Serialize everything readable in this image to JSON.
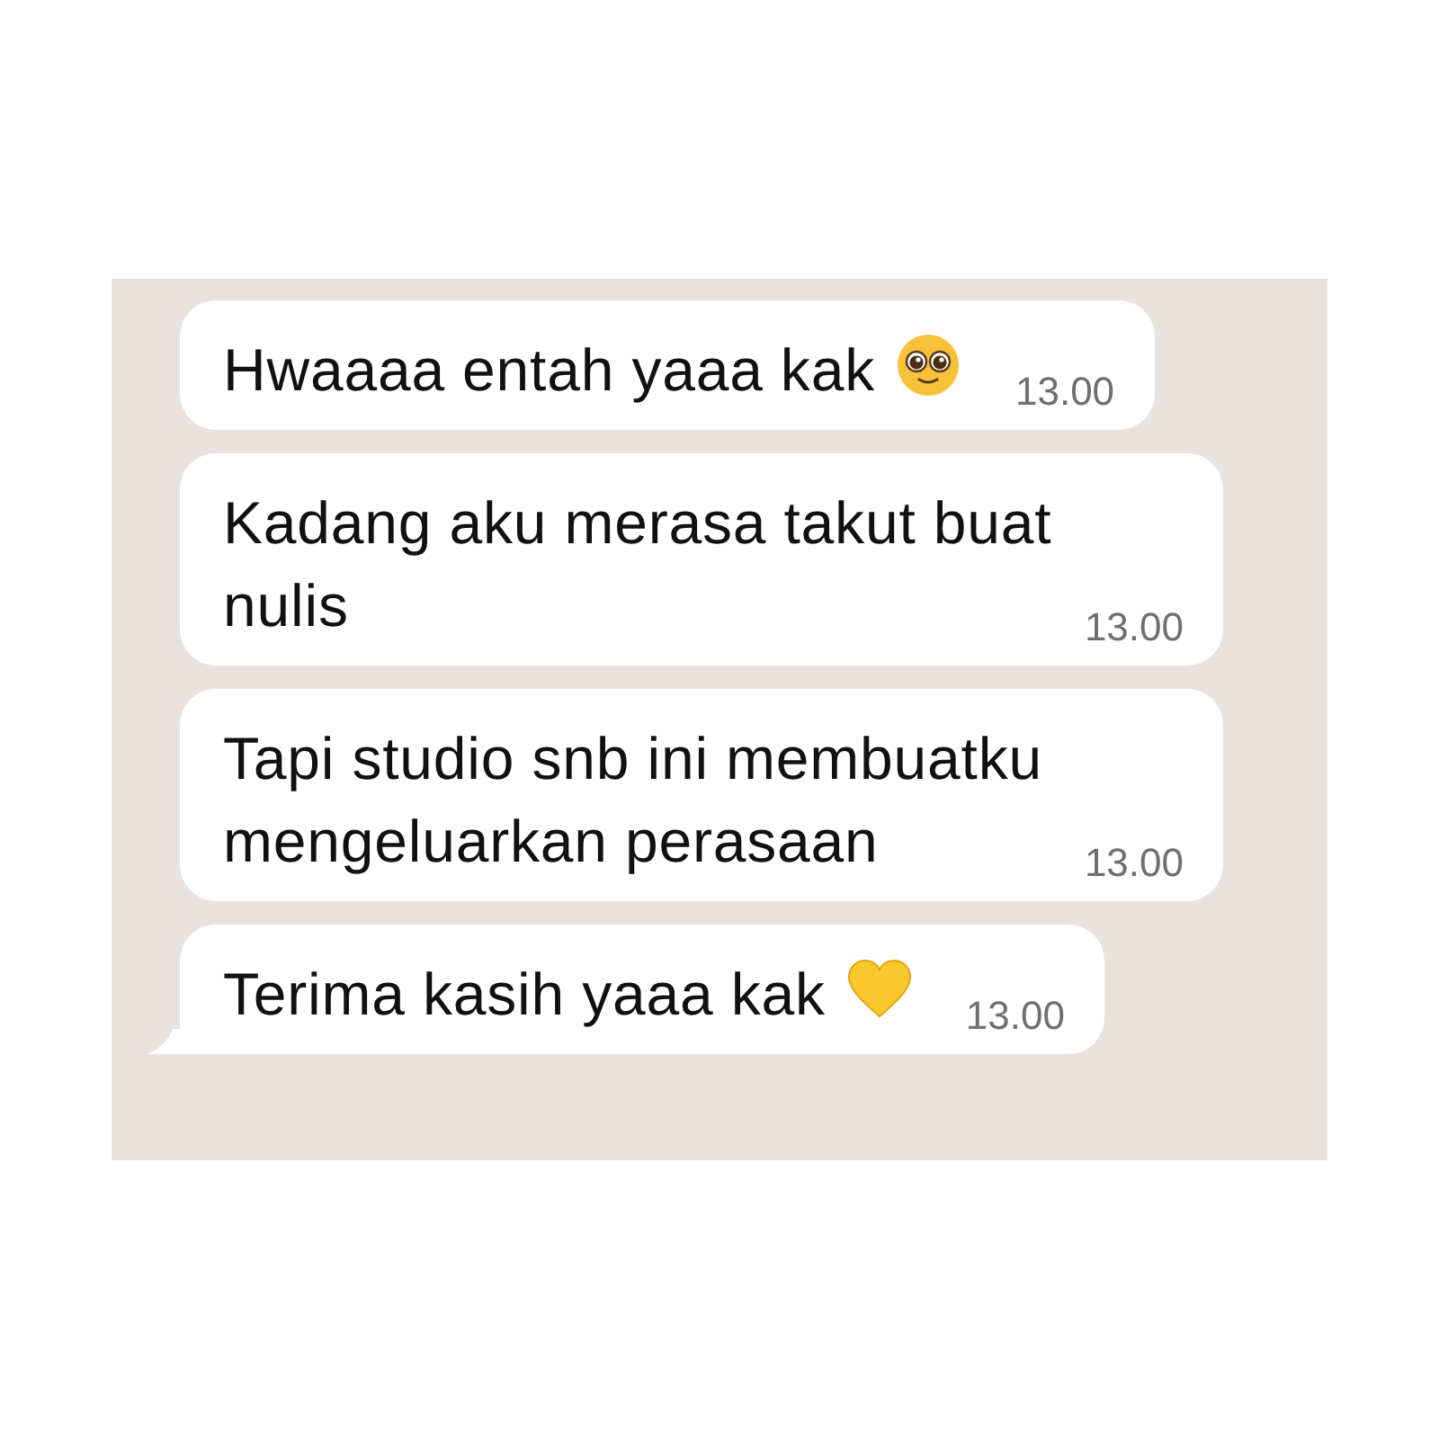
{
  "messages": [
    {
      "text": "Hwaaaa entah yaaa kak",
      "kind": "face",
      "time": "13.00",
      "tail": false
    },
    {
      "text": "Kadang aku merasa takut buat nulis",
      "kind": "plain",
      "time": "13.00",
      "tail": false
    },
    {
      "text": "Tapi studio snb ini membuatku mengeluarkan perasaan",
      "kind": "plain",
      "time": "13.00",
      "tail": false
    },
    {
      "text": "Terima kasih yaaa kak",
      "kind": "heart",
      "time": "13.00",
      "tail": true
    }
  ]
}
